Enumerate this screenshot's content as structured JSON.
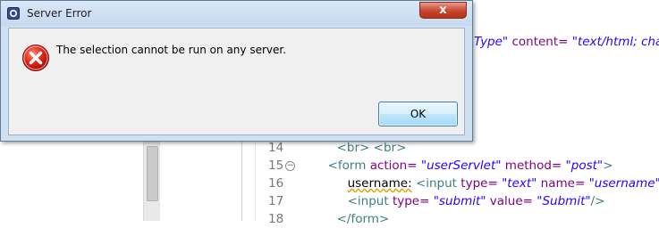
{
  "dialog": {
    "title": "Server Error",
    "icon": "error-icon",
    "message": "The selection cannot be run on any server.",
    "ok_label": "OK",
    "close_label": "x"
  },
  "editor": {
    "top_fragment": {
      "value1": "Type\"",
      "attr": "content=",
      "value2": "\"text/html; char"
    },
    "lines": [
      {
        "num": "14",
        "tag1": "<br>",
        "tag2": "<br>"
      },
      {
        "num": "15",
        "open": "<form",
        "a1": "action=",
        "v1": "\"userServlet\"",
        "a2": "method=",
        "v2": "\"post\"",
        "close": ">"
      },
      {
        "num": "16",
        "text": "username:",
        "tag": "<input",
        "a1": "type=",
        "v1": "\"text\"",
        "a2": "name=",
        "v2": "\"username\"",
        "close": "/>"
      },
      {
        "num": "17",
        "tag": "<input",
        "a1": "type=",
        "v1": "\"submit\"",
        "a2": "value=",
        "v2": "\"Submit\"",
        "close": "/>"
      },
      {
        "num": "18",
        "tag": "</form>"
      }
    ]
  }
}
